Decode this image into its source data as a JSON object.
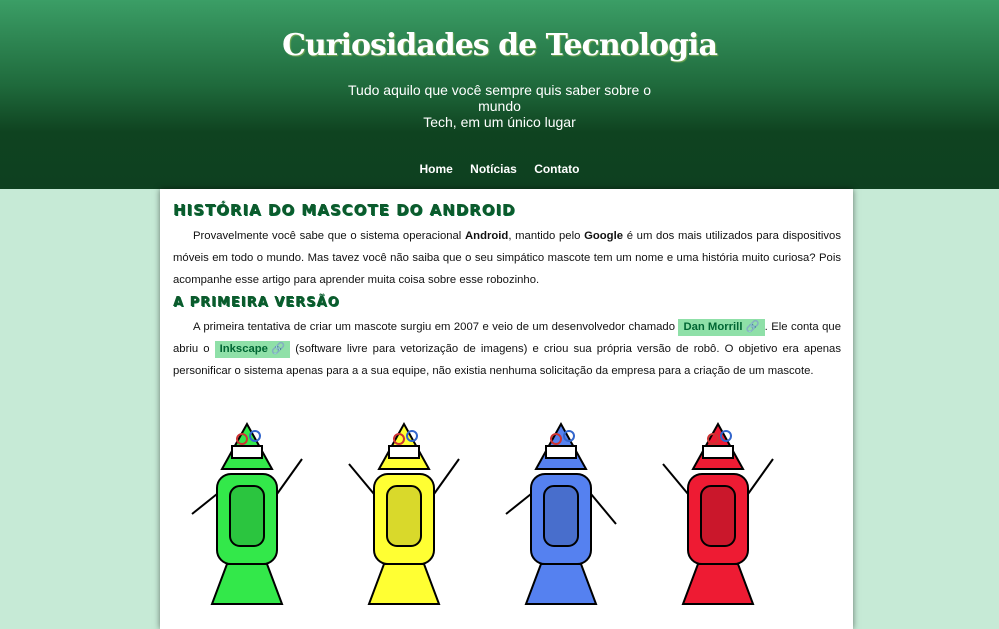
{
  "header": {
    "title": "Curiosidades de Tecnologia",
    "subtitle_line1": "Tudo aquilo que você sempre quis saber sobre o mundo",
    "subtitle_line2": "Tech, em um único lugar"
  },
  "nav": [
    {
      "label": "Home"
    },
    {
      "label": "Notícias"
    },
    {
      "label": "Contato"
    }
  ],
  "article": {
    "title": "História do mascote do Android",
    "p1": {
      "a": "Provavelmente você sabe que o sistema operacional ",
      "b": "Android",
      "c": ", mantido pelo ",
      "d": "Google",
      "e": " é um dos mais utilizados para dispositivos móveis em todo o mundo. Mas tavez você não saiba que o seu simpático mascote tem um nome e uma história muito curiosa? Pois acompanhe esse artigo para aprender muita coisa sobre esse robozinho."
    },
    "section1": "A primeira versão",
    "p2": {
      "a": "A primeira tentativa de criar um mascote surgiu em 2007 e veio de um desenvolvedor chamado ",
      "link1": "Dan Morrill",
      "b": ". Ele conta que abriu o ",
      "link2": "Inkscape",
      "c": " (software livre para vetorização de imagens) e criou sua própria versão de robô. O objetivo era apenas personificar o sistema apenas para a a sua equipe, não existia nenhuma solicitação da empresa para a criação de um mascote."
    },
    "robot_colors": [
      "#33e84a",
      "#ffff33",
      "#5581f0",
      "#ee1b33"
    ]
  }
}
